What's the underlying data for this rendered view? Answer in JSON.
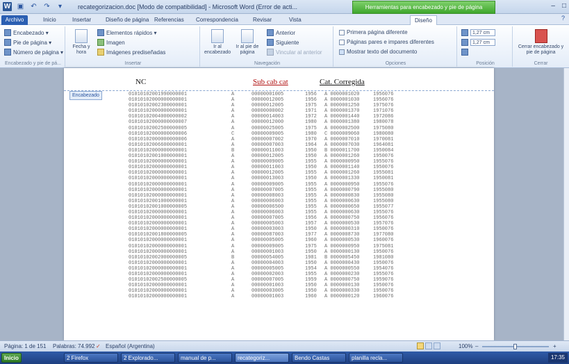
{
  "titlebar": {
    "title": "recategorizacion.doc [Modo de compatibilidad] - Microsoft Word (Error de acti...",
    "context_tab": "Herramientas para encabezado y pie de página",
    "win_min": "–",
    "win_max": "□",
    "win_close": "×"
  },
  "tabs": {
    "file": "Archivo",
    "items": [
      "Inicio",
      "Insertar",
      "Diseño de página",
      "Referencias",
      "Correspondencia",
      "Revisar",
      "Vista"
    ],
    "active": "Diseño",
    "help": "?"
  },
  "ribbon": {
    "hf_group": {
      "label": "Encabezado y pie de pá...",
      "header": "Encabezado ▾",
      "footer": "Pie de página ▾",
      "page_number": "Número de página ▾"
    },
    "insert_group": {
      "label": "Insertar",
      "date_time": "Fecha y hora",
      "quick_parts": "Elementos rápidos ▾",
      "picture": "Imagen",
      "clip_art": "Imágenes prediseñadas"
    },
    "nav_group": {
      "label": "Navegación",
      "goto_header": "Ir al encabezado",
      "goto_footer": "Ir al pie de página",
      "previous": "Anterior",
      "next": "Siguiente",
      "link_previous": "Vincular al anterior"
    },
    "options_group": {
      "label": "Opciones",
      "diff_first": "Primera página diferente",
      "diff_odd_even": "Páginas pares e impares diferentes",
      "show_text": "Mostrar texto del documento"
    },
    "position_group": {
      "label": "Posición",
      "header_from_top": "1,27 cm",
      "footer_from_bottom": "1,27 cm"
    },
    "close_group": {
      "label": "Cerrar",
      "close": "Cerrar encabezado y pie de página"
    }
  },
  "document": {
    "header_tag": "Encabezado",
    "col_headers": [
      "NC",
      "Sub cab cat",
      "Cat. Corregida"
    ],
    "rows": [
      [
        "01010102001990000001",
        "A",
        "00000001005",
        "1956",
        "A 0000001020",
        "1956076"
      ],
      [
        "01010102000000000001",
        "A",
        "00000012005",
        "1956",
        "A 0000001030",
        "1956076"
      ],
      [
        "01010102002300000001",
        "A",
        "00000012005",
        "1975",
        "A 0000001250",
        "1975076"
      ],
      [
        "01010102000000000001",
        "A",
        "00000000002",
        "1971",
        "A 0000001370",
        "1971076"
      ],
      [
        "01010102004000000002",
        "A",
        "00000014003",
        "1972",
        "A 0000001440",
        "1972086"
      ],
      [
        "01010102000000000007",
        "A",
        "00000012000",
        "1980",
        "A 0000001380",
        "1980078"
      ],
      [
        "01010102002500000005",
        "A",
        "00000025005",
        "1975",
        "A 0000002500",
        "1975080"
      ],
      [
        "01010102000000000006",
        "C",
        "00000009005",
        "1980",
        "C 0000009060",
        "1980080"
      ],
      [
        "01010102000000000006",
        "A",
        "00000007002",
        "1970",
        "A 0000007010",
        "1970081"
      ],
      [
        "01010102006600000001",
        "A",
        "00000007003",
        "1964",
        "A 0000007030",
        "1964081"
      ],
      [
        "01010102000000000001",
        "B",
        "00000011003",
        "1950",
        "B 0000011700",
        "1950084"
      ],
      [
        "01010102001000000001",
        "A",
        "00000012005",
        "1950",
        "A 0000001260",
        "1950076"
      ],
      [
        "01010102000000000001",
        "A",
        "00000009005",
        "1955",
        "A 0000000950",
        "1955076"
      ],
      [
        "01010102000000000001",
        "A",
        "00000011003",
        "1950",
        "A 0000001140",
        "1950076"
      ],
      [
        "01010102000000000001",
        "A",
        "00000012005",
        "1955",
        "A 0000001260",
        "1955081"
      ],
      [
        "01010102000000000001",
        "A",
        "00000013003",
        "1950",
        "A 0000001330",
        "1950081"
      ],
      [
        "01010102000000000001",
        "A",
        "00000009005",
        "1955",
        "A 0000000950",
        "1955076"
      ],
      [
        "01010102000000000001",
        "A",
        "00000007005",
        "1955",
        "A 0000000790",
        "1955080"
      ],
      [
        "01010102000000000001",
        "A",
        "00000008003",
        "1955",
        "A 0000000830",
        "1955080"
      ],
      [
        "01010102001000000001",
        "A",
        "00000006003",
        "1955",
        "A 0000000630",
        "1955080"
      ],
      [
        "01010102001000000005",
        "A",
        "00000006500",
        "1955",
        "A 0000000650",
        "1955077"
      ],
      [
        "01010102000000000001",
        "A",
        "00000006003",
        "1955",
        "A 0000000630",
        "1955076"
      ],
      [
        "01010102000000000001",
        "A",
        "00000007005",
        "1956",
        "A 0000000750",
        "1956076"
      ],
      [
        "01010102000000000001",
        "A",
        "00000005003",
        "1957",
        "A 0000000530",
        "1957076"
      ],
      [
        "01010102000000000001",
        "A",
        "00000003003",
        "1950",
        "A 0000000310",
        "1950076"
      ],
      [
        "01010102001800000005",
        "A",
        "00000087003",
        "1977",
        "A 0000008730",
        "1977080"
      ],
      [
        "01010102000000000001",
        "A",
        "00000005005",
        "1960",
        "A 0000000530",
        "1960076"
      ],
      [
        "01010102000000000001",
        "A",
        "00000009005",
        "1975",
        "A 0000000950",
        "1975081"
      ],
      [
        "01010102000000000001",
        "A",
        "00000001003",
        "1950",
        "A 0000000130",
        "1950076"
      ],
      [
        "01010102002000000005",
        "B",
        "00000054005",
        "1981",
        "B 0000005450",
        "1981080"
      ],
      [
        "01010102000000000001",
        "A",
        "00000004003",
        "1950",
        "A 0000000430",
        "1950076"
      ],
      [
        "01010102000000000001",
        "A",
        "00000005005",
        "1954",
        "A 0000000550",
        "1954076"
      ],
      [
        "01010102000000000001",
        "A",
        "00000002003",
        "1955",
        "A 0000000230",
        "1955076"
      ],
      [
        "01010102002500000005",
        "A",
        "00000007005",
        "1959",
        "A 0000000750",
        "1959076"
      ],
      [
        "01010102000000000001",
        "A",
        "00000001003",
        "1950",
        "A 0000000130",
        "1950076"
      ],
      [
        "01010102000000000001",
        "A",
        "00000003005",
        "1950",
        "A 0000000330",
        "1950076"
      ],
      [
        "01010102000000000001",
        "A",
        "00000001003",
        "1960",
        "A 0000000120",
        "1960076"
      ]
    ]
  },
  "status": {
    "page": "Página: 1 de 151",
    "words": "Palabras: 74.992",
    "language": "Español (Argentina)",
    "zoom": "100%",
    "zoom_minus": "–",
    "zoom_plus": "+",
    "zoom_level": 0.5
  },
  "taskbar": {
    "start": "Inicio",
    "items": [
      "2 Firefox",
      "2 Explorado...",
      "manual de p...",
      "recategoriz...",
      "Bendo Castas",
      "planilla recla..."
    ],
    "tray_time": "17:35"
  }
}
